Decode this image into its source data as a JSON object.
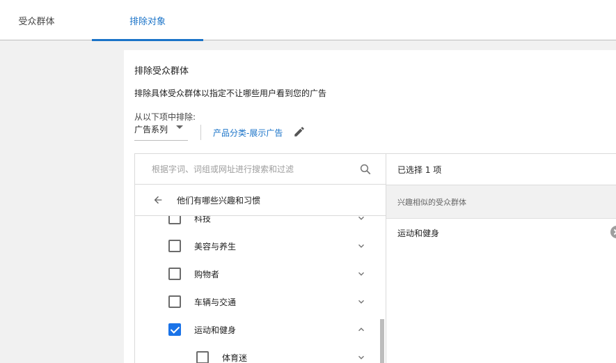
{
  "tabs": [
    {
      "label": "受众群体"
    },
    {
      "label": "排除对象"
    }
  ],
  "panel": {
    "heading": "排除受众群体",
    "description": "排除具体受众群体以指定不让哪些用户看到您的广告",
    "from_label": "从以下项中排除:",
    "dropdown_value": "广告系列",
    "link_text": "产品分类-展示广告"
  },
  "search": {
    "placeholder": "根据字词、词组或网址进行搜索和过滤"
  },
  "back_title": "他们有哪些兴趣和习惯",
  "items": [
    {
      "label": "科技",
      "checked": false,
      "expanded": false
    },
    {
      "label": "美容与养生",
      "checked": false,
      "expanded": false
    },
    {
      "label": "购物者",
      "checked": false,
      "expanded": false
    },
    {
      "label": "车辆与交通",
      "checked": false,
      "expanded": false
    },
    {
      "label": "运动和健身",
      "checked": true,
      "expanded": true
    },
    {
      "label": "体育迷",
      "checked": false,
      "expanded": false
    }
  ],
  "selected": {
    "count_text": "已选择 1 项",
    "group_header": "兴趣相似的受众群体",
    "items": [
      "运动和健身"
    ]
  },
  "colors": {
    "accent": "#1a73c8",
    "checkbox_checked": "#1a73e8"
  }
}
